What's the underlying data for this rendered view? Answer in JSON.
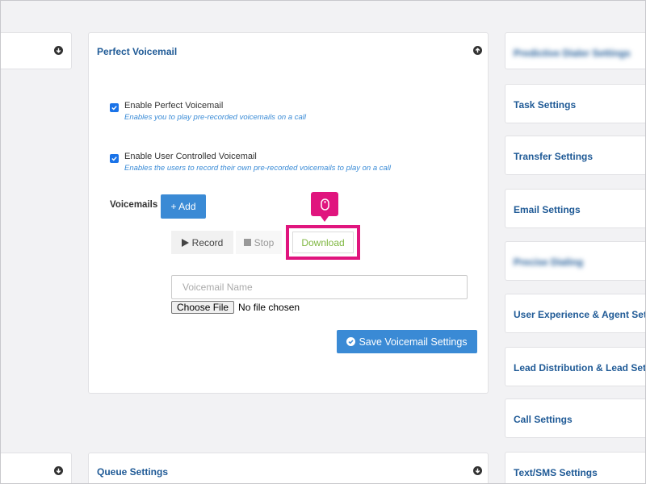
{
  "left": {
    "top_toggle_icon": "down-circle",
    "bottom_toggle_icon": "down-circle"
  },
  "center": {
    "title": "Perfect Voicemail",
    "toggle_icon": "up-circle",
    "options": [
      {
        "label": "Enable Perfect Voicemail",
        "help": "Enables you to play pre-recorded voicemails on a call",
        "checked": true
      },
      {
        "label": "Enable User Controlled Voicemail",
        "help": "Enables the users to record their own pre-recorded voicemails to play on a call",
        "checked": true
      }
    ],
    "voicemails_label": "Voicemails",
    "add_button": "+ Add",
    "record_button": "Record",
    "stop_button": "Stop",
    "download_button": "Download",
    "voicemail_name_placeholder": "Voicemail Name",
    "choose_file_button": "Choose File",
    "no_file_text": "No file chosen",
    "save_button": "Save Voicemail Settings",
    "colors": {
      "highlight": "#e0157e",
      "accent": "#3a8ad5",
      "download_text": "#7fb741"
    }
  },
  "center_bottom": {
    "title": "Queue Settings",
    "toggle_icon": "down-circle"
  },
  "right": [
    {
      "label": "Predictive Dialer Settings",
      "blurred": true
    },
    {
      "label": "Task Settings"
    },
    {
      "label": "Transfer Settings"
    },
    {
      "label": "Email Settings"
    },
    {
      "label": "Precise Dialing",
      "blurred": true
    },
    {
      "label": "User Experience & Agent Setti"
    },
    {
      "label": "Lead Distribution & Lead Setti"
    },
    {
      "label": "Call Settings"
    },
    {
      "label": "Text/SMS Settings"
    }
  ]
}
